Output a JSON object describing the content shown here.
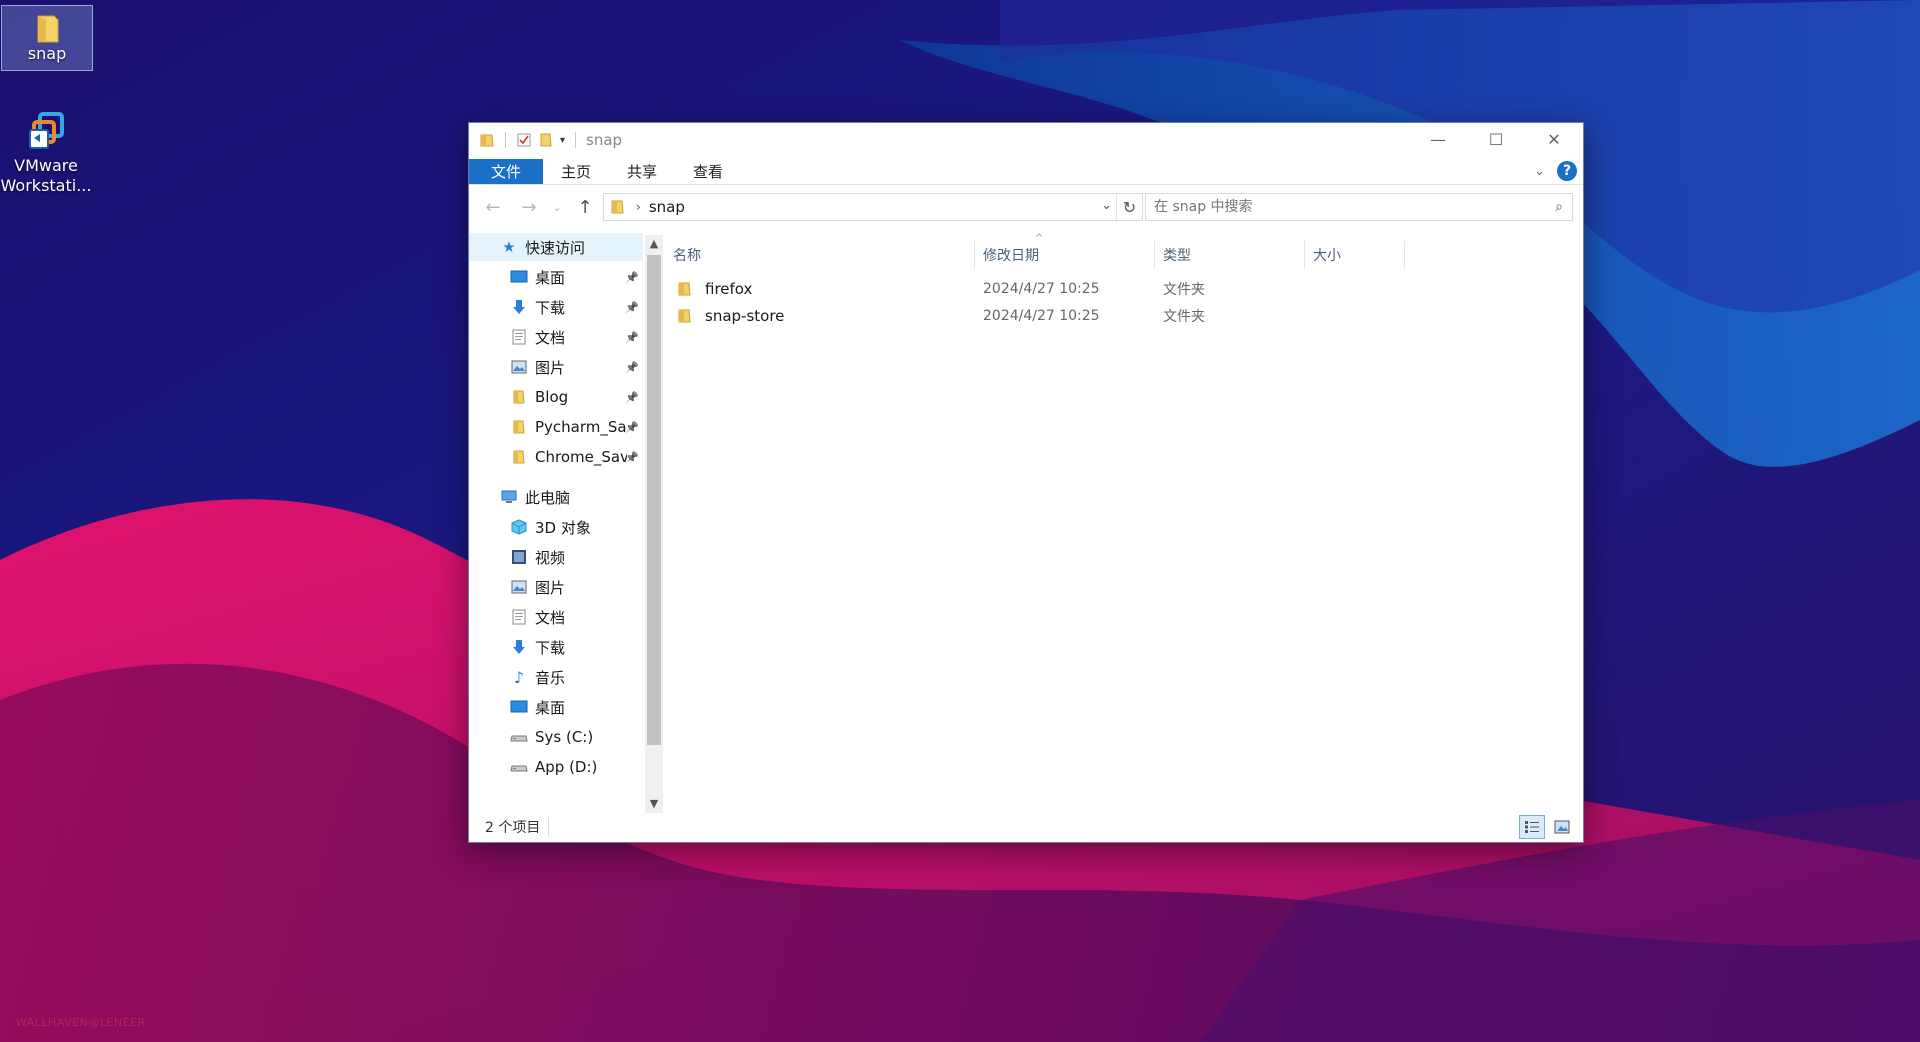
{
  "desktop": {
    "icons": [
      {
        "label": "snap",
        "icon": "folder-icon"
      },
      {
        "label": "VMware\nWorkstati...",
        "icon": "vmware-icon"
      }
    ],
    "watermark": "WALLHAVEN@LENEER"
  },
  "window": {
    "title": "snap",
    "controls": {
      "minimize": "—",
      "maximize": "☐",
      "close": "✕"
    },
    "ribbon": {
      "tabs": [
        {
          "label": "文件"
        },
        {
          "label": "主页"
        },
        {
          "label": "共享"
        },
        {
          "label": "查看"
        }
      ],
      "help": "?"
    },
    "address": {
      "crumbs": [
        "snap"
      ]
    },
    "search": {
      "placeholder": "在 snap 中搜索"
    },
    "nav": {
      "quick_access": "快速访问",
      "quick_items": [
        {
          "label": "桌面",
          "icon": "desktop-icon",
          "pinned": true
        },
        {
          "label": "下载",
          "icon": "download-icon",
          "pinned": true
        },
        {
          "label": "文档",
          "icon": "document-icon",
          "pinned": true
        },
        {
          "label": "图片",
          "icon": "picture-icon",
          "pinned": true
        },
        {
          "label": "Blog",
          "icon": "folder-icon",
          "pinned": true
        },
        {
          "label": "Pycharm_Sav",
          "icon": "folder-icon",
          "pinned": true
        },
        {
          "label": "Chrome_Sav",
          "icon": "folder-icon",
          "pinned": true
        }
      ],
      "this_pc": "此电脑",
      "pc_items": [
        {
          "label": "3D 对象",
          "icon": "cube-icon"
        },
        {
          "label": "视频",
          "icon": "video-icon"
        },
        {
          "label": "图片",
          "icon": "picture-icon"
        },
        {
          "label": "文档",
          "icon": "document-icon"
        },
        {
          "label": "下载",
          "icon": "download-icon"
        },
        {
          "label": "音乐",
          "icon": "music-icon"
        },
        {
          "label": "桌面",
          "icon": "desktop-icon"
        },
        {
          "label": "Sys (C:)",
          "icon": "drive-icon"
        },
        {
          "label": "App (D:)",
          "icon": "drive-icon"
        }
      ]
    },
    "columns": [
      "名称",
      "修改日期",
      "类型",
      "大小"
    ],
    "files": [
      {
        "name": "firefox",
        "date": "2024/4/27 10:25",
        "type": "文件夹",
        "size": ""
      },
      {
        "name": "snap-store",
        "date": "2024/4/27 10:25",
        "type": "文件夹",
        "size": ""
      }
    ],
    "status": {
      "count": "2 个项目"
    }
  }
}
